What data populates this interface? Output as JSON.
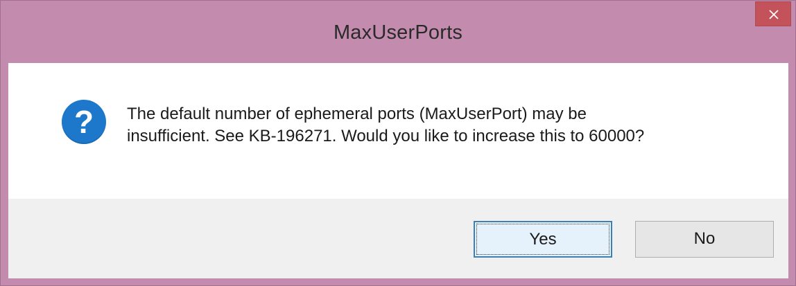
{
  "window": {
    "title": "MaxUserPorts",
    "close_icon": "close-icon"
  },
  "dialog": {
    "icon": "question-icon",
    "icon_glyph": "?",
    "message_line1": "The default number of ephemeral ports (MaxUserPort) may be",
    "message_line2": "insufficient. See KB-196271. Would you like to increase this to 60000?"
  },
  "buttons": {
    "yes_label": "Yes",
    "no_label": "No"
  },
  "colors": {
    "frame": "#c38bae",
    "close_button": "#c4525a",
    "icon_blue": "#1d78cc",
    "footer": "#f0f0f0"
  }
}
